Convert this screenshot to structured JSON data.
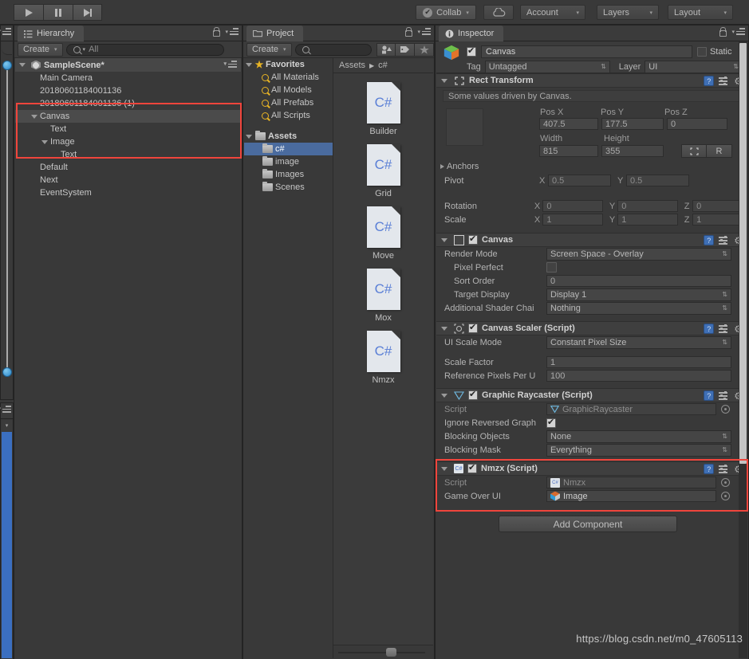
{
  "toolbar": {
    "play_icon": "play-icon",
    "pause_icon": "pause-icon",
    "step_icon": "step-icon",
    "collab_label": "Collab",
    "collab_check": "✔",
    "cloud_icon": "cloud-icon",
    "account_label": "Account",
    "layers_label": "Layers",
    "layout_label": "Layout",
    "caret": "▾"
  },
  "hierarchy": {
    "tab_label": "Hierarchy",
    "tab_icon": "hierarchy-icon",
    "create_label": "Create",
    "search_placeholder": "All",
    "search_value": "All",
    "scene_name": "SampleScene*",
    "items": [
      {
        "label": "Main Camera",
        "depth": 1,
        "arrow": "none"
      },
      {
        "label": "20180601184001136",
        "depth": 1,
        "arrow": "none"
      },
      {
        "label": "20180601184001136 (1)",
        "depth": 1,
        "arrow": "none"
      },
      {
        "label": "Canvas",
        "depth": 1,
        "arrow": "open",
        "selected": true
      },
      {
        "label": "Text",
        "depth": 2,
        "arrow": "none"
      },
      {
        "label": "Image",
        "depth": 2,
        "arrow": "open"
      },
      {
        "label": "Text",
        "depth": 3,
        "arrow": "none"
      },
      {
        "label": "Default",
        "depth": 1,
        "arrow": "none"
      },
      {
        "label": "Next",
        "depth": 1,
        "arrow": "none"
      },
      {
        "label": "EventSystem",
        "depth": 1,
        "arrow": "none"
      }
    ]
  },
  "project": {
    "tab_label": "Project",
    "tab_icon": "folder-icon",
    "create_label": "Create",
    "search_placeholder": "",
    "icons": [
      "filter-by-type-icon",
      "filter-by-label-icon",
      "favorites-star-icon"
    ],
    "favorites_label": "Favorites",
    "favorites": [
      "All Materials",
      "All Models",
      "All Prefabs",
      "All Scripts"
    ],
    "assets_label": "Assets",
    "folders": [
      {
        "label": "c#",
        "selected": true
      },
      {
        "label": "image",
        "selected": false
      },
      {
        "label": "Images",
        "selected": false
      },
      {
        "label": "Scenes",
        "selected": false
      }
    ],
    "breadcrumb": [
      "Assets",
      "c#"
    ],
    "breadcrumb_sep": "▶",
    "assets": [
      {
        "label": "Builder",
        "type": "C#"
      },
      {
        "label": "Grid",
        "type": "C#"
      },
      {
        "label": "Move",
        "type": "C#"
      },
      {
        "label": "Mox",
        "type": "C#"
      },
      {
        "label": "Nmzx",
        "type": "C#"
      }
    ]
  },
  "inspector": {
    "tab_label": "Inspector",
    "tab_icon": "info-icon",
    "object_name": "Canvas",
    "object_enabled": true,
    "static_label": "Static",
    "tag_label": "Tag",
    "tag_value": "Untagged",
    "layer_label": "Layer",
    "layer_value": "UI",
    "components": [
      {
        "name": "Rect Transform",
        "icon": "rect-transform-icon",
        "note": "Some values driven by Canvas.",
        "fields": {
          "pos_x_label": "Pos X",
          "pos_x": "407.5",
          "pos_y_label": "Pos Y",
          "pos_y": "177.5",
          "pos_z_label": "Pos Z",
          "pos_z": "0",
          "width_label": "Width",
          "width": "815",
          "height_label": "Height",
          "height": "355",
          "blueprint_btn": "blueprint-mode-icon",
          "raw_btn": "R",
          "anchors_label": "Anchors",
          "pivot_label": "Pivot",
          "pivot_x": "0.5",
          "pivot_y": "0.5",
          "rotation_label": "Rotation",
          "rot_x": "0",
          "rot_y": "0",
          "rot_z": "0",
          "scale_label": "Scale",
          "scale_x": "1",
          "scale_y": "1",
          "scale_z": "1"
        }
      },
      {
        "name": "Canvas",
        "icon": "canvas-icon",
        "enabled": true,
        "rows": [
          {
            "label": "Render Mode",
            "value": "Screen Space - Overlay",
            "type": "popup"
          },
          {
            "label": "Pixel Perfect",
            "value": "",
            "type": "checkbox"
          },
          {
            "label": "Sort Order",
            "value": "0",
            "type": "text"
          },
          {
            "label": "Target Display",
            "value": "Display 1",
            "type": "popup"
          },
          {
            "label": "Additional Shader Chai",
            "value": "Nothing",
            "type": "popup"
          }
        ]
      },
      {
        "name": "Canvas Scaler (Script)",
        "icon": "canvas-scaler-icon",
        "enabled": true,
        "rows": [
          {
            "label": "UI Scale Mode",
            "value": "Constant Pixel Size",
            "type": "popup"
          },
          {
            "label": "Scale Factor",
            "value": "1",
            "type": "text"
          },
          {
            "label": "Reference Pixels Per U",
            "value": "100",
            "type": "text"
          }
        ]
      },
      {
        "name": "Graphic Raycaster (Script)",
        "icon": "graphic-raycaster-icon",
        "enabled": true,
        "rows": [
          {
            "label": "Script",
            "value": "GraphicRaycaster",
            "type": "object-dim"
          },
          {
            "label": "Ignore Reversed Graph",
            "value": "",
            "type": "checkbox-on"
          },
          {
            "label": "Blocking Objects",
            "value": "None",
            "type": "popup"
          },
          {
            "label": "Blocking Mask",
            "value": "Everything",
            "type": "popup"
          }
        ]
      },
      {
        "name": "Nmzx (Script)",
        "icon": "cs-script-icon",
        "enabled": true,
        "highlighted": true,
        "rows": [
          {
            "label": "Script",
            "value": "Nmzx",
            "type": "object-dim"
          },
          {
            "label": "Game Over UI",
            "value": "Image",
            "type": "object-image"
          }
        ]
      }
    ],
    "add_component_label": "Add Component"
  },
  "watermark": "https://blog.csdn.net/m0_47605113",
  "colors": {
    "background": "#393939",
    "panel_header": "#3b3b3b",
    "selection_blue": "#4a6b9e",
    "highlight_red": "#f0453c",
    "star_yellow": "#e8b425",
    "csharp_blue": "#5a7fd6"
  }
}
